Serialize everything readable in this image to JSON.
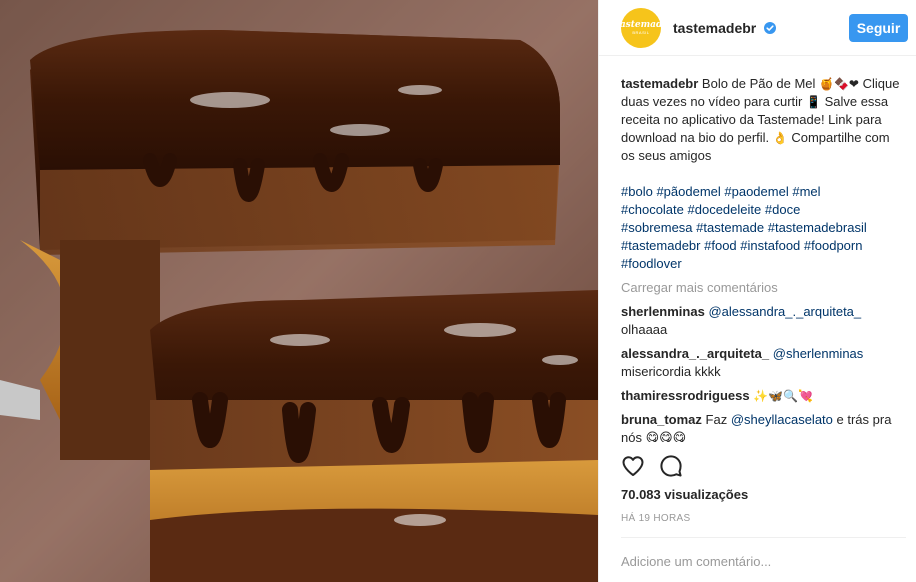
{
  "post": {
    "username": "tastemadebr",
    "avatar_logo": "Tastemade",
    "avatar_sub": "BRASIL",
    "verified_icon": "verified-badge-icon",
    "follow_label": "Seguir",
    "accent_color": "#3897f0",
    "avatar_color": "#f6c41b"
  },
  "caption": {
    "user": "tastemadebr",
    "text_1": " Bolo de Pão de Mel ",
    "emoji_1": "🍯🍫❤",
    "text_2": " Clique duas vezes no vídeo para curtir ",
    "emoji_2": "📱",
    "text_3": " Salve essa receita no aplicativo da Tastemade! Link para download na bio do perfil. ",
    "emoji_3": "👌",
    "text_4": " Compartilhe com os seus amigos"
  },
  "hashtags": [
    "#bolo",
    "#pãodemel",
    "#paodemel",
    "#mel",
    "#chocolate",
    "#docedeleite",
    "#doce",
    "#sobremesa",
    "#tastemade",
    "#tastemadebrasil",
    "#tastemadebr",
    "#food",
    "#instafood",
    "#foodporn",
    "#foodlover"
  ],
  "load_more_label": "Carregar mais comentários",
  "comments": [
    {
      "user": "sherlenminas",
      "mention": "@alessandra_._arquiteta_",
      "text": " olhaaaa"
    },
    {
      "user": "alessandra_._arquiteta_",
      "mention": "@sherlenminas",
      "text": " misericordia kkkk"
    },
    {
      "user": "thamiressrodriguess",
      "mention": "",
      "text": " ✨🦋🔍💘"
    },
    {
      "user": "bruna_tomaz",
      "mention": "@sheyllacaselato",
      "text_before": " Faz ",
      "text": " e trás pra nós 😋😋😋"
    }
  ],
  "actions": {
    "like_icon": "heart-icon",
    "comment_icon": "comment-icon"
  },
  "views_label": "70.083 visualizações",
  "time_label": "HÁ 19 HORAS",
  "add_comment_placeholder": "Adicione um comentário..."
}
